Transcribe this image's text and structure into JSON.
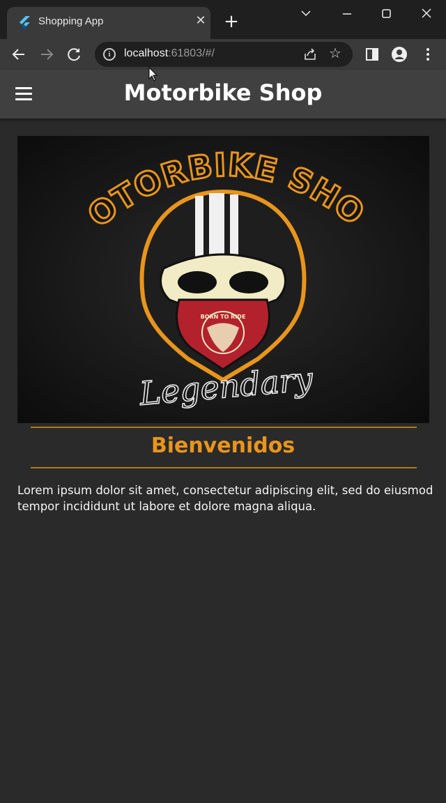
{
  "browser": {
    "tab_title": "Shopping App",
    "tab_close": "✕",
    "new_tab": "+",
    "url_host": "localhost",
    "url_rest": ":61803/#/",
    "window_controls": [
      "chevron-down-icon",
      "minimize-icon",
      "maximize-icon",
      "close-icon"
    ]
  },
  "app": {
    "title": "Motorbike Shop",
    "menu_icon": "hamburger-menu-icon",
    "banner": {
      "logo_text_top": "MOTORBIKE SHOP",
      "logo_text_bottom": "Legendary",
      "bandana_text": "BORN TO RIDE"
    },
    "welcome": "Bienvenidos",
    "body": "Lorem ipsum dolor sit amet, consectetur adipiscing elit, sed do eiusmod tempor incididunt ut labore et dolore magna aliqua."
  },
  "colors": {
    "accent": "#e9951c",
    "appbar": "#404040",
    "background": "#2a2a2a",
    "bandana": "#b3212d",
    "skull": "#f1ecc6"
  }
}
